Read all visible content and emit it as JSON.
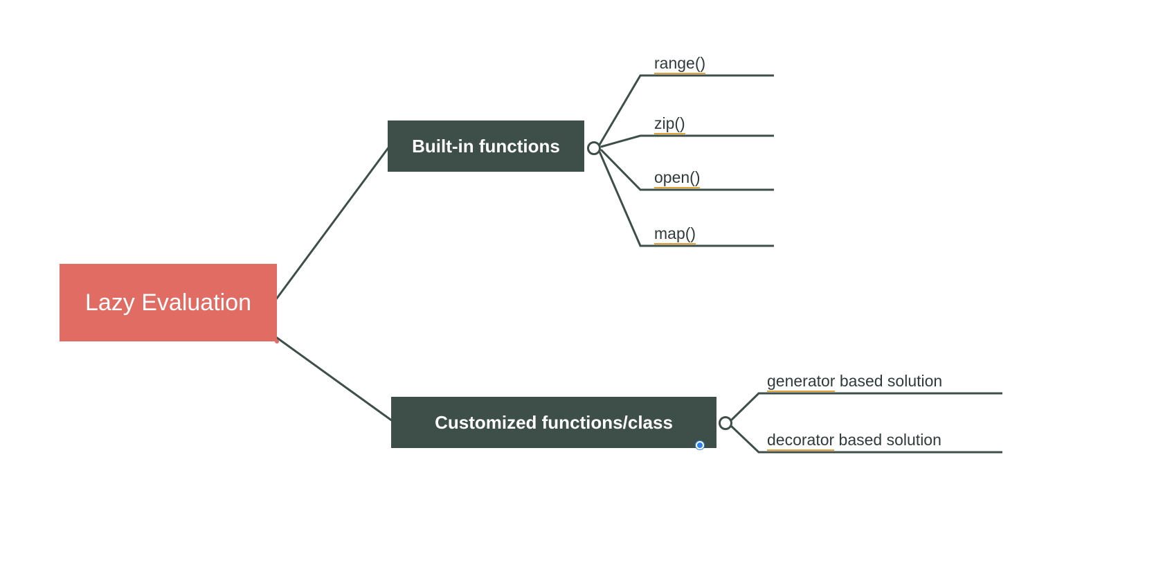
{
  "colors": {
    "root": "#E06C63",
    "branch": "#3E4F4A",
    "accent": "#E0A23A",
    "hubStroke": "#3E4F4A",
    "blueDot": "#2F80ED"
  },
  "root": {
    "label": "Lazy Evaluation"
  },
  "branch1": {
    "label": "Built-in functions",
    "leaves": [
      {
        "label": "range()"
      },
      {
        "label": "zip()"
      },
      {
        "label": "open()"
      },
      {
        "label": "map()"
      }
    ]
  },
  "branch2": {
    "label": "Customized functions/class",
    "leaves": [
      {
        "prefix": "generator",
        "suffix": " based solution"
      },
      {
        "prefix": "decorator",
        "suffix": " based solution"
      }
    ]
  }
}
